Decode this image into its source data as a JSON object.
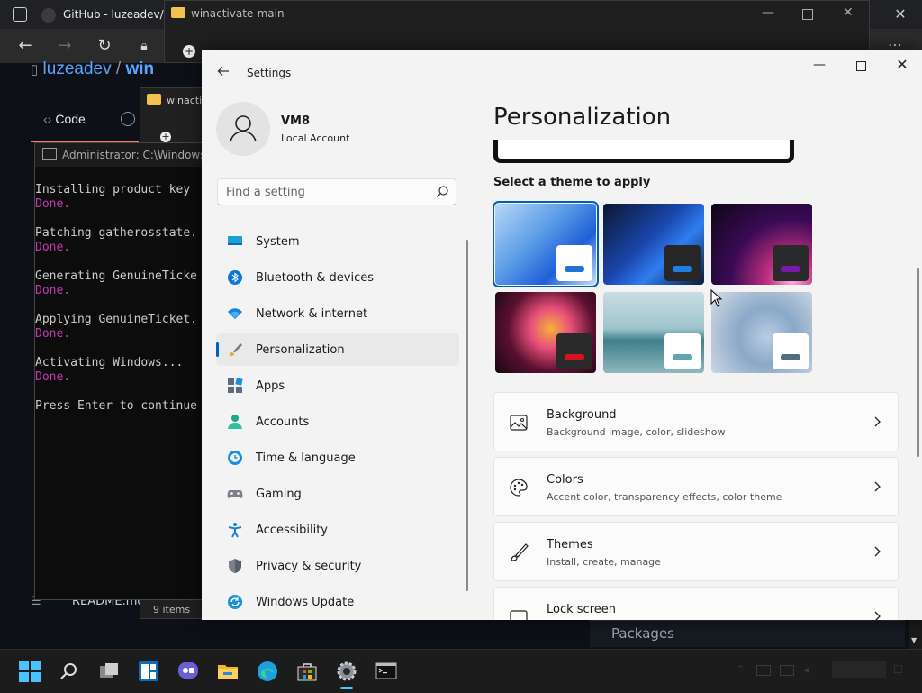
{
  "browser": {
    "tab_title": "GitHub - luzeadev/",
    "breadcrumb_owner": "luzeadev",
    "breadcrumb_sep": "/",
    "breadcrumb_repo": "win",
    "code_tab": "Code",
    "readme_label": "README.md",
    "packages_label": "Packages"
  },
  "explorer": {
    "title": "winactivate-main",
    "title2": "winacti",
    "status": "9 items"
  },
  "console": {
    "title": "Administrator: C:\\Windows\\S",
    "lines": [
      {
        "text": "Installing product key",
        "done": false
      },
      {
        "text": "Done.",
        "done": true
      },
      {
        "text": "",
        "done": false
      },
      {
        "text": "Patching gatherosstate.",
        "done": false
      },
      {
        "text": "Done.",
        "done": true
      },
      {
        "text": "",
        "done": false
      },
      {
        "text": "Generating GenuineTicke",
        "done": false
      },
      {
        "text": "Done.",
        "done": true
      },
      {
        "text": "",
        "done": false
      },
      {
        "text": "Applying GenuineTicket.",
        "done": false
      },
      {
        "text": "Done.",
        "done": true
      },
      {
        "text": "",
        "done": false
      },
      {
        "text": "Activating Windows...",
        "done": false
      },
      {
        "text": "Done.",
        "done": true
      },
      {
        "text": "",
        "done": false
      },
      {
        "text": "Press Enter to continue",
        "done": false
      }
    ]
  },
  "settings": {
    "app_title": "Settings",
    "user": {
      "name": "VM8",
      "account_type": "Local Account"
    },
    "search": {
      "placeholder": "Find a setting",
      "value": ""
    },
    "nav": [
      {
        "label": "System",
        "icon": "system-icon",
        "active": false
      },
      {
        "label": "Bluetooth & devices",
        "icon": "bluetooth-icon",
        "active": false
      },
      {
        "label": "Network & internet",
        "icon": "network-icon",
        "active": false
      },
      {
        "label": "Personalization",
        "icon": "personalization-icon",
        "active": true
      },
      {
        "label": "Apps",
        "icon": "apps-icon",
        "active": false
      },
      {
        "label": "Accounts",
        "icon": "accounts-icon",
        "active": false
      },
      {
        "label": "Time & language",
        "icon": "time-language-icon",
        "active": false
      },
      {
        "label": "Gaming",
        "icon": "gaming-icon",
        "active": false
      },
      {
        "label": "Accessibility",
        "icon": "accessibility-icon",
        "active": false
      },
      {
        "label": "Privacy & security",
        "icon": "privacy-icon",
        "active": false
      },
      {
        "label": "Windows Update",
        "icon": "windows-update-icon",
        "active": false
      }
    ],
    "page_title": "Personalization",
    "theme_heading": "Select a theme to apply",
    "themes": [
      {
        "id": "windows-light",
        "selected": true,
        "bg": "linear-gradient(135deg,#b8d8f5 0%,#5d9ee8 40%,#1e5fd8 70%,#c8e0f8 100%)",
        "win": "#ffffff",
        "accent": "#1e73d0"
      },
      {
        "id": "windows-dark",
        "selected": false,
        "bg": "linear-gradient(135deg,#0b1630 0%,#1b47b0 45%,#2f7df0 65%,#0a1a3a 100%)",
        "win": "#262626",
        "accent": "#1e7fe0"
      },
      {
        "id": "glow",
        "selected": false,
        "bg": "radial-gradient(circle at 80% 95%,#ffb0e0 0%,#c0307f 22%,#3a0a55 55%,#0e0616 100%)",
        "win": "#2a2a2a",
        "accent": "#7a1aa8"
      },
      {
        "id": "captured-motion",
        "selected": false,
        "bg": "radial-gradient(circle at 55% 45%,#f5b23a 0%,#e8507a 28%,#5a1030 60%,#140810 100%)",
        "win": "#2a2a2a",
        "accent": "#d81020"
      },
      {
        "id": "sunrise",
        "selected": false,
        "bg": "linear-gradient(180deg,#c8dde2 0%,#9ec4cc 45%,#3d7f8c 60%,#8fb7bd 100%)",
        "win": "#ffffff",
        "accent": "#5fa6b4"
      },
      {
        "id": "flow",
        "selected": false,
        "bg": "radial-gradient(circle at 55% 55%,#b9cde2 0%,#8aa8c8 40%,#d5dde6 100%)",
        "win": "#ffffff",
        "accent": "#4f6c80"
      }
    ],
    "cards": [
      {
        "title": "Background",
        "subtitle": "Background image, color, slideshow",
        "icon": "background-image-icon"
      },
      {
        "title": "Colors",
        "subtitle": "Accent color, transparency effects, color theme",
        "icon": "palette-icon"
      },
      {
        "title": "Themes",
        "subtitle": "Install, create, manage",
        "icon": "brush-icon"
      },
      {
        "title": "Lock screen",
        "subtitle": "",
        "icon": "lock-screen-icon"
      }
    ]
  },
  "taskbar": {
    "apps": [
      "start-icon",
      "search-icon",
      "task-view-icon",
      "widgets-icon",
      "chat-icon",
      "file-explorer-icon",
      "edge-icon",
      "store-icon",
      "settings-icon",
      "terminal-icon"
    ]
  }
}
